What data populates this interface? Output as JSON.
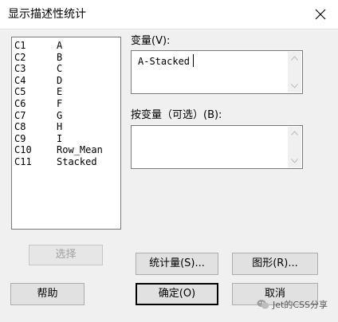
{
  "dialog": {
    "title": "显示描述性统计"
  },
  "variables": [
    {
      "col": "C1",
      "name": "A"
    },
    {
      "col": "C2",
      "name": "B"
    },
    {
      "col": "C3",
      "name": "C"
    },
    {
      "col": "C4",
      "name": "D"
    },
    {
      "col": "C5",
      "name": "E"
    },
    {
      "col": "C6",
      "name": "F"
    },
    {
      "col": "C7",
      "name": "G"
    },
    {
      "col": "C8",
      "name": "H"
    },
    {
      "col": "C9",
      "name": "I"
    },
    {
      "col": "C10",
      "name": "Row_Mean"
    },
    {
      "col": "C11",
      "name": "Stacked"
    }
  ],
  "fields": {
    "variables_label": "变量(V):",
    "variables_value": "A-Stacked",
    "by_variable_label": "按变量（可选）(B):",
    "by_variable_value": ""
  },
  "buttons": {
    "select": "选择",
    "statistics": "统计量(S)...",
    "graphs": "图形(R)...",
    "help": "帮助",
    "ok": "确定(O)",
    "cancel": "取消"
  },
  "watermark": {
    "text": "Jet的CSS分享",
    "icon": "wechat-icon"
  }
}
